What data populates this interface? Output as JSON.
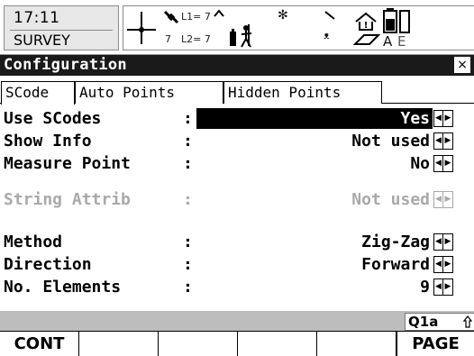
{
  "statusbar": {
    "time": "17:11",
    "mode": "SURVEY",
    "tripod_digit": "7",
    "l1_label": "L1= 7",
    "l2_label": "L2= 7",
    "memory_letter": "A",
    "memory_letter2": "E"
  },
  "window": {
    "title": "Configuration",
    "close": "×"
  },
  "tabs": [
    {
      "label": "SCode"
    },
    {
      "label": "Auto Points"
    },
    {
      "label": "Hidden Points"
    }
  ],
  "fields": [
    {
      "label": "Use SCodes",
      "value": "Yes"
    },
    {
      "label": "Show Info",
      "value": "Not used"
    },
    {
      "label": "Measure Point",
      "value": "No"
    },
    {
      "label": "String Attrib",
      "value": "Not used"
    },
    {
      "label": "Method",
      "value": "Zig-Zag"
    },
    {
      "label": "Direction",
      "value": "Forward"
    },
    {
      "label": "No. Elements",
      "value": "9"
    }
  ],
  "colon": ":",
  "input_mode": "Q1a",
  "softkeys": {
    "f1": "CONT",
    "f2": "",
    "f3": "",
    "f4": "",
    "f5": "",
    "f6": "PAGE"
  }
}
